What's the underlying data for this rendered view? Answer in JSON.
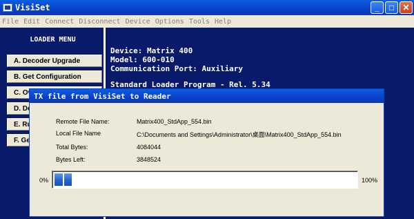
{
  "window": {
    "title": "VisiSet",
    "buttons": {
      "minimize": "_",
      "maximize": "□",
      "close": "✕"
    }
  },
  "menubar": [
    "File",
    "Edit",
    "Connect",
    "Disconnect",
    "Device",
    "Options",
    "Tools",
    "Help"
  ],
  "left_panel": {
    "title": "LOADER MENU",
    "buttons": [
      "A. Decoder Upgrade",
      "B. Get Configuration",
      "C. Ov",
      "D. De",
      "E. Ru",
      "F. Ge"
    ]
  },
  "console": {
    "lines": [
      "Device: Matrix 400",
      "Model: 600-010",
      "Communication Port: Auxiliary",
      "",
      "Standard Loader Program - Rel. 5.34"
    ]
  },
  "dialog": {
    "title": "TX file from VisiSet to Reader",
    "fields": [
      {
        "label": "Remote File Name:",
        "value": "Matrix400_StdApp_554.bin"
      },
      {
        "label": "Local File Name",
        "value": "C:\\Documents and Settings\\Administrator\\桌面\\Matrix400_StdApp_554.bin"
      },
      {
        "label": "Total Bytes:",
        "value": "4084044"
      },
      {
        "label": "Bytes Left:",
        "value": "3848524"
      }
    ],
    "progress": {
      "min_label": "0%",
      "max_label": "100%",
      "fraction": 0.058
    }
  },
  "colors": {
    "console_bg": "#0a1a6a",
    "titlebar": "#0b3fc8",
    "dialog_bg": "#ece9d8",
    "progress": "#2a66d0"
  }
}
